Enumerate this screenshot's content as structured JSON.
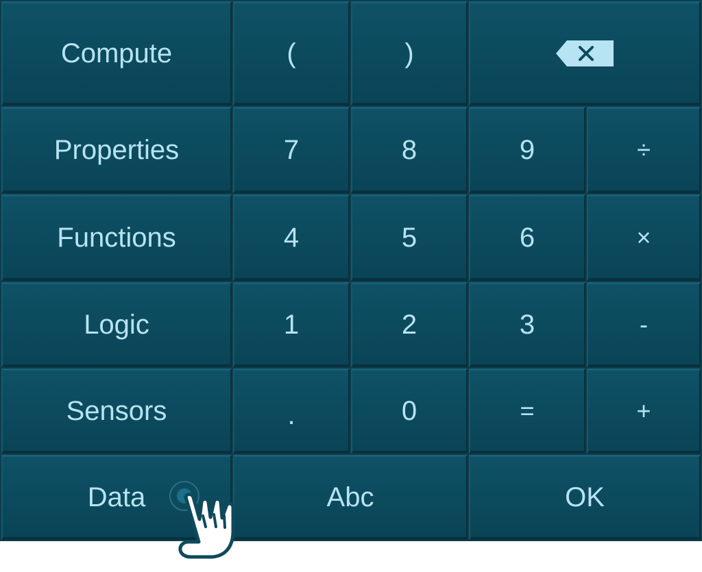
{
  "keys": {
    "compute": "Compute",
    "open_paren": "(",
    "close_paren": ")",
    "properties": "Properties",
    "seven": "7",
    "eight": "8",
    "nine": "9",
    "divide": "÷",
    "functions": "Functions",
    "four": "4",
    "five": "5",
    "six": "6",
    "multiply": "×",
    "logic": "Logic",
    "one": "1",
    "two": "2",
    "three": "3",
    "minus": "-",
    "sensors": "Sensors",
    "decimal": ".",
    "zero": "0",
    "equals": "=",
    "plus": "+",
    "data": "Data",
    "abc": "Abc",
    "ok": "OK"
  },
  "icons": {
    "backspace": "backspace-icon",
    "pointer": "tap-hand-icon"
  },
  "colors": {
    "key_face": "#0c4a5d",
    "key_text": "#b7e3f2",
    "background": "#0f3d4c"
  }
}
